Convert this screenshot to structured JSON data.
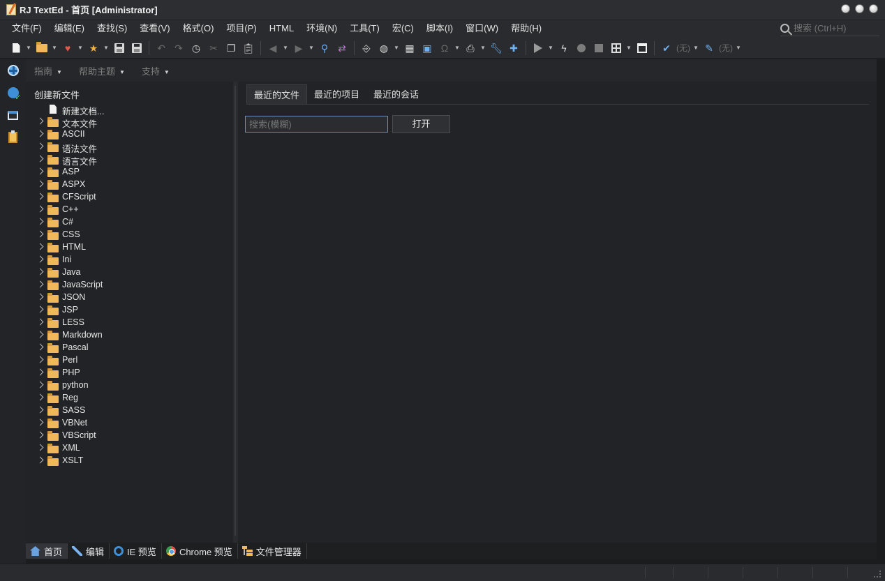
{
  "window": {
    "title": "RJ TextEd - 首页 [Administrator]"
  },
  "menu": [
    "文件(F)",
    "编辑(E)",
    "查找(S)",
    "查看(V)",
    "格式(O)",
    "项目(P)",
    "HTML",
    "环境(N)",
    "工具(T)",
    "宏(C)",
    "脚本(I)",
    "窗口(W)",
    "帮助(H)"
  ],
  "global_search": {
    "placeholder": "搜索 (Ctrl+H)"
  },
  "toolbar": {
    "spell_none_label": "(无)",
    "highlight_none_label": "(无)"
  },
  "subbar": {
    "guide": "指南",
    "help_topics": "帮助主题",
    "support": "支持"
  },
  "left_pane": {
    "title": "创建新文件",
    "new_doc": "新建文档...",
    "folders": [
      "文本文件",
      "ASCII",
      "语法文件",
      "语言文件",
      "ASP",
      "ASPX",
      "CFScript",
      "C++",
      "C#",
      "CSS",
      "HTML",
      "Ini",
      "Java",
      "JavaScript",
      "JSON",
      "JSP",
      "LESS",
      "Markdown",
      "Pascal",
      "Perl",
      "PHP",
      "python",
      "Reg",
      "SASS",
      "VBNet",
      "VBScript",
      "XML",
      "XSLT"
    ]
  },
  "right_pane": {
    "tabs": [
      "最近的文件",
      "最近的项目",
      "最近的会话"
    ],
    "active_tab": 0,
    "search_placeholder": "搜索(模糊)",
    "open_button": "打开"
  },
  "bottom_tabs": [
    "首页",
    "编辑",
    "IE 预览",
    "Chrome 预览",
    "文件管理器"
  ],
  "colors": {
    "background": "#222326",
    "folder": "#f0b85a",
    "accent": "#6c8db5"
  }
}
